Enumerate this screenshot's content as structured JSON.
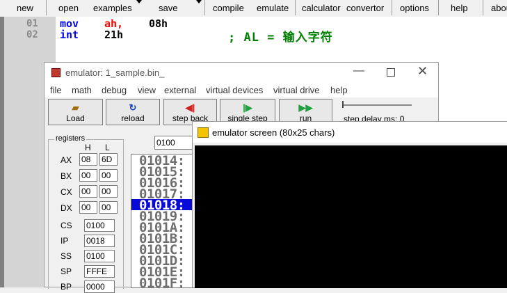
{
  "toolbar": {
    "new": "new",
    "open": "open",
    "examples": "examples",
    "save": "save",
    "compile": "compile",
    "emulate": "emulate",
    "calculator": "calculator",
    "convertor": "convertor",
    "options": "options",
    "help": "help",
    "about": "about"
  },
  "editor": {
    "lines": [
      {
        "num": "01",
        "mnemonic": "mov",
        "operand1": "ah,",
        "operand2": "08h",
        "comment": ""
      },
      {
        "num": "02",
        "mnemonic": "int",
        "operand1": "21h",
        "operand2": "",
        "comment": "; AL = 输入字符"
      }
    ],
    "colors": {
      "mnemonic": "#0000ff",
      "register": "#ff0000",
      "number": "#000000",
      "comment": "#008000"
    }
  },
  "emulator": {
    "title": "emulator: 1_sample.bin_",
    "menu": [
      "file",
      "math",
      "debug",
      "view",
      "external",
      "virtual devices",
      "virtual drive",
      "help"
    ],
    "buttons": {
      "load": "Load",
      "reload": "reload",
      "step_back": "step back",
      "single_step": "single step",
      "run": "run",
      "step_delay": "step delay ms: 0"
    },
    "address_field": "0100",
    "registers": {
      "group_label": "registers",
      "h_header": "H",
      "l_header": "L",
      "ax": {
        "label": "AX",
        "h": "08",
        "l": "6D"
      },
      "bx": {
        "label": "BX",
        "h": "00",
        "l": "00"
      },
      "cx": {
        "label": "CX",
        "h": "00",
        "l": "00"
      },
      "dx": {
        "label": "DX",
        "h": "00",
        "l": "00"
      },
      "cs": {
        "label": "CS",
        "value": "0100"
      },
      "ip": {
        "label": "IP",
        "value": "0018"
      },
      "ss": {
        "label": "SS",
        "value": "0100"
      },
      "sp": {
        "label": "SP",
        "value": "FFFE"
      },
      "bp": {
        "label": "BP",
        "value": "0000"
      }
    },
    "memory": [
      "01014:",
      "01015:",
      "01016:",
      "01017:",
      "01018:",
      "01019:",
      "0101A:",
      "0101B:",
      "0101C:",
      "0101D:",
      "0101E:",
      "0101F:"
    ],
    "selected_memory_index": 4
  },
  "screen": {
    "title": "emulator screen (80x25 chars)"
  }
}
